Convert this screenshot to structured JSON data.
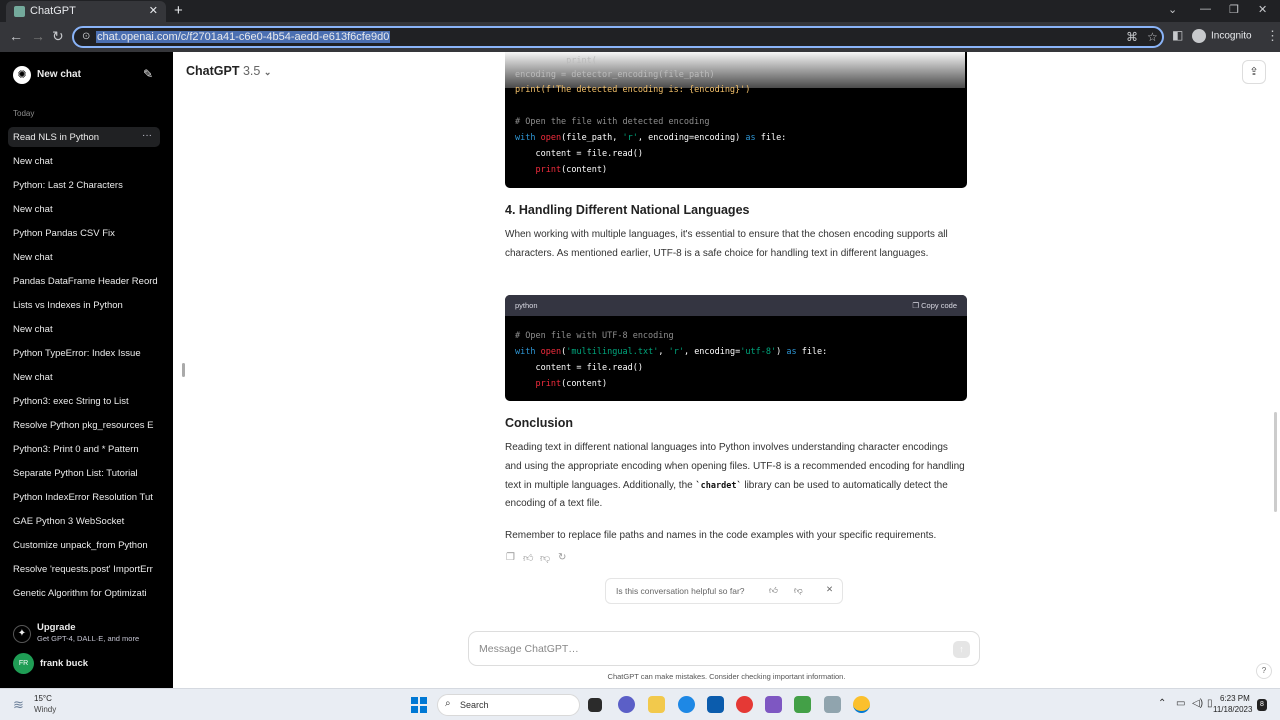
{
  "browser": {
    "tab_title": "ChatGPT",
    "tab_close": "✕",
    "new_tab": "+",
    "url": "chat.openai.com/c/f2701a41-c6e0-4b54-aedd-e613f6cfe9d0",
    "profile_label": "Incognito",
    "window_controls": [
      "⌄",
      "—",
      "❐",
      "✕"
    ]
  },
  "sidebar": {
    "new_chat_label": "New chat",
    "section_today": "Today",
    "items": [
      {
        "label": "Read NLS in Python",
        "active": true
      },
      {
        "label": "New chat"
      },
      {
        "label": "Python: Last 2 Characters"
      },
      {
        "label": "New chat"
      },
      {
        "label": "Python Pandas CSV Fix"
      },
      {
        "label": "New chat"
      },
      {
        "label": "Pandas DataFrame Header Reord"
      },
      {
        "label": "Lists vs Indexes in Python"
      },
      {
        "label": "New chat"
      },
      {
        "label": "Python TypeError: Index Issue"
      },
      {
        "label": "New chat"
      },
      {
        "label": "Python3: exec String to List"
      },
      {
        "label": "Resolve Python pkg_resources E"
      },
      {
        "label": "Python3: Print 0 and * Pattern"
      },
      {
        "label": "Separate Python List: Tutorial"
      },
      {
        "label": "Python IndexError Resolution Tut"
      },
      {
        "label": "GAE Python 3 WebSocket"
      },
      {
        "label": "Customize unpack_from Python"
      },
      {
        "label": "Resolve 'requests.post' ImportErr"
      },
      {
        "label": "Genetic Algorithm for Optimizati"
      }
    ],
    "more_glyph": "···",
    "upgrade_title": "Upgrade",
    "upgrade_subtitle": "Get GPT-4, DALL·E, and more",
    "user_initials": "FR",
    "user_name": "frank buck"
  },
  "header": {
    "model_name": "ChatGPT",
    "model_version": "3.5"
  },
  "content": {
    "code1_lines_faded": [
      "          print(",
      "encoding = detector_encoding(file_path)",
      "print(f'The detected encoding is: {encoding}')"
    ],
    "code1_comment": "# Open the file with detected encoding",
    "code1_with": "with",
    "code1_open": "open",
    "code1_args_a": "(file_path, ",
    "code1_r": "'r'",
    "code1_args_b": ", encoding=encoding) ",
    "code1_as": "as",
    "code1_file": " file:",
    "code1_content": "    content = file.read()",
    "code1_print": "print",
    "code1_print_arg": "(content)",
    "heading_4": "4. Handling Different National Languages",
    "para_4": "When working with multiple languages, it's essential to ensure that the chosen encoding supports all characters. As mentioned earlier, UTF-8 is a safe choice for handling text in different languages.",
    "code2_lang": "python",
    "code2_copy": "Copy code",
    "code2_comment": "# Open file with UTF-8 encoding",
    "code2_with": "with",
    "code2_open": "open",
    "code2_fname": "'multilingual.txt'",
    "code2_r": "'r'",
    "code2_enc_key": ", encoding=",
    "code2_enc_val": "'utf-8'",
    "code2_as": "as",
    "code2_file": " file:",
    "code2_content": "    content = file.read()",
    "code2_print": "print",
    "code2_print_arg": "(content)",
    "heading_conclusion": "Conclusion",
    "para_conclusion_a": "Reading text in different national languages into Python involves understanding character encodings and using the appropriate encoding when opening files. UTF-8 is a recommended encoding for handling text in multiple languages. Additionally, the ",
    "para_conclusion_code": "`chardet`",
    "para_conclusion_b": " library can be used to automatically detect the encoding of a text file.",
    "para_reminder": "Remember to replace file paths and names in the code examples with your specific requirements."
  },
  "feedback": {
    "question": "Is this conversation helpful so far?"
  },
  "composer": {
    "placeholder": "Message ChatGPT…"
  },
  "disclaimer": "ChatGPT can make mistakes. Consider checking important information.",
  "help": "?",
  "taskbar": {
    "temperature": "15°C",
    "condition": "Windy",
    "search_label": "Search",
    "time": "6:23 PM",
    "date": "11/18/2023",
    "notifications": "8"
  }
}
